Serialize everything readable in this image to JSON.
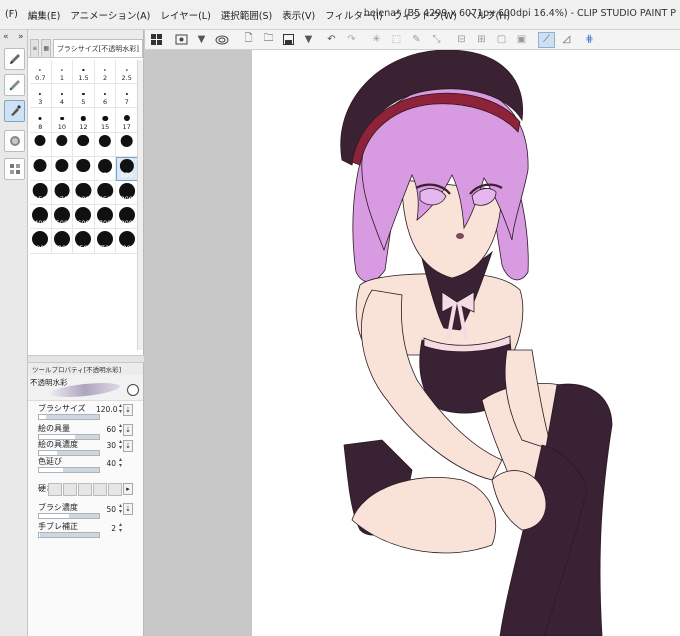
{
  "menu": {
    "items": [
      "(F)",
      "編集(E)",
      "アニメーション(A)",
      "レイヤー(L)",
      "選択範囲(S)",
      "表示(V)",
      "フィルター(I)",
      "ウィンドウ(W)",
      "ヘルプ(H)"
    ]
  },
  "window": {
    "title": "helena* (B5 4299 x 6071px 600dpi 16.4%) - CLIP STUDIO PAINT P"
  },
  "brush_panel": {
    "tab_label": "ブラシサイズ[不透明水彩]",
    "sizes": [
      "0.7",
      "1",
      "1.5",
      "2",
      "2.5",
      "3",
      "4",
      "5",
      "6",
      "7",
      "8",
      "10",
      "12",
      "15",
      "17",
      "20",
      "25",
      "30",
      "40",
      "50",
      "60",
      "70",
      "80",
      "100",
      "120",
      "150",
      "170",
      "200",
      "250",
      "300",
      "400",
      "500",
      "600",
      "700",
      "800",
      "1000",
      "1200",
      "1500",
      "1700",
      "2000"
    ],
    "selected": "120"
  },
  "tool_property": {
    "tab_label": "ツールプロパティ[不透明水彩]",
    "tool_name": "不透明水彩",
    "brush_size_label": "ブラシサイズ",
    "brush_size_value": "120.0",
    "brush_size_level": 0.12,
    "paint_amount_label": "絵の具量",
    "paint_amount_value": "60",
    "paint_amount_level": 0.6,
    "paint_density_label": "絵の具濃度",
    "paint_density_value": "30",
    "paint_density_level": 0.3,
    "color_stretch_label": "色延び",
    "color_stretch_value": "40",
    "color_stretch_level": 0.4,
    "hardness_label": "硬さ",
    "brush_density_label": "ブラシ濃度",
    "brush_density_value": "50",
    "brush_density_level": 0.5,
    "stabilization_label": "手ブレ補正",
    "stabilization_value": "2",
    "stabilization_level": 0.02
  },
  "colors": {
    "hat": "#3a2233",
    "hat_band": "#8e2238",
    "hair": "#d89ae0",
    "skin": "#f9e2d8",
    "outfit": "#3a2235",
    "ribbon": "#f6dbe4",
    "eyes": "#e6b7ef"
  }
}
